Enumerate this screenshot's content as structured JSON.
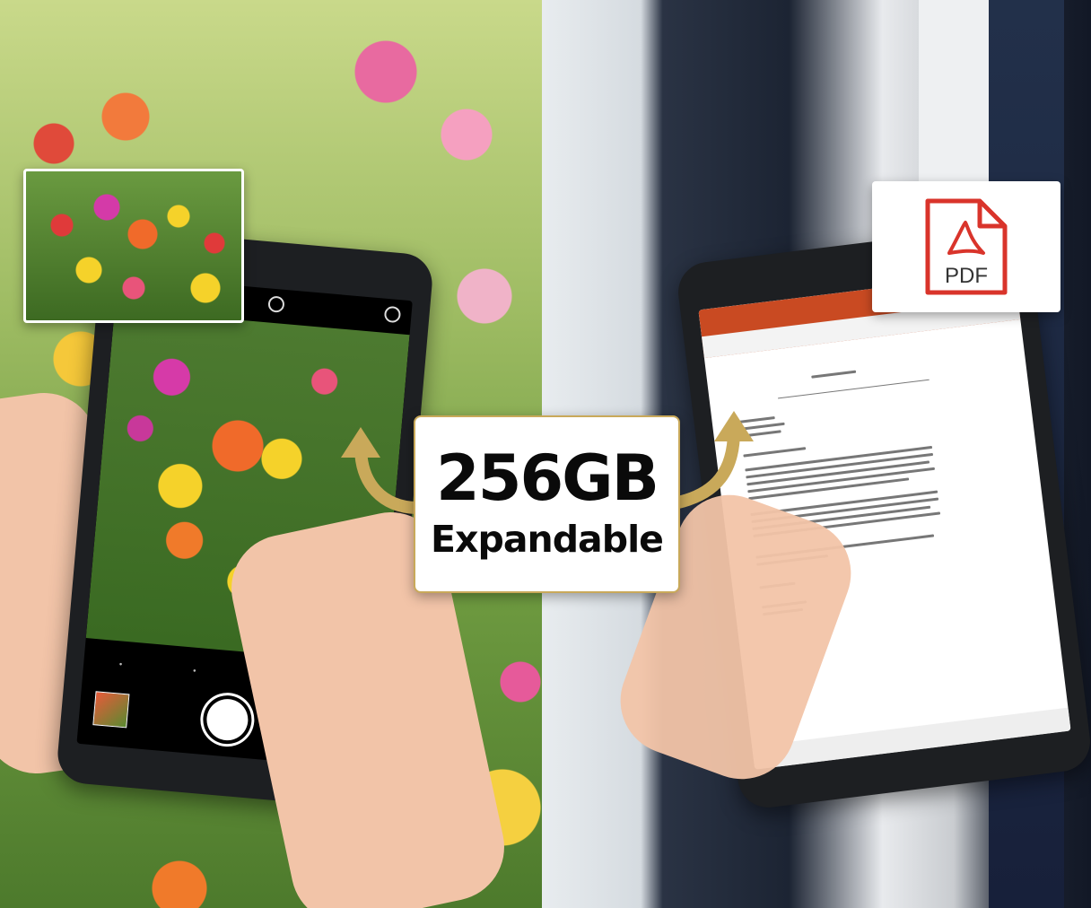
{
  "badge": {
    "size": "256GB",
    "label": "Expandable"
  },
  "pdf_card": {
    "label": "PDF"
  },
  "left_phone": {
    "time": "",
    "modes": [
      "",
      ""
    ]
  },
  "colors": {
    "badge_border": "#c9a95a",
    "arrow": "#c9a95a",
    "pdf_red": "#d9342b",
    "ribbon": "#c94a22"
  },
  "icons": [
    "adobe-pdf-icon",
    "shutter-button-icon",
    "camera-switch-icon"
  ]
}
